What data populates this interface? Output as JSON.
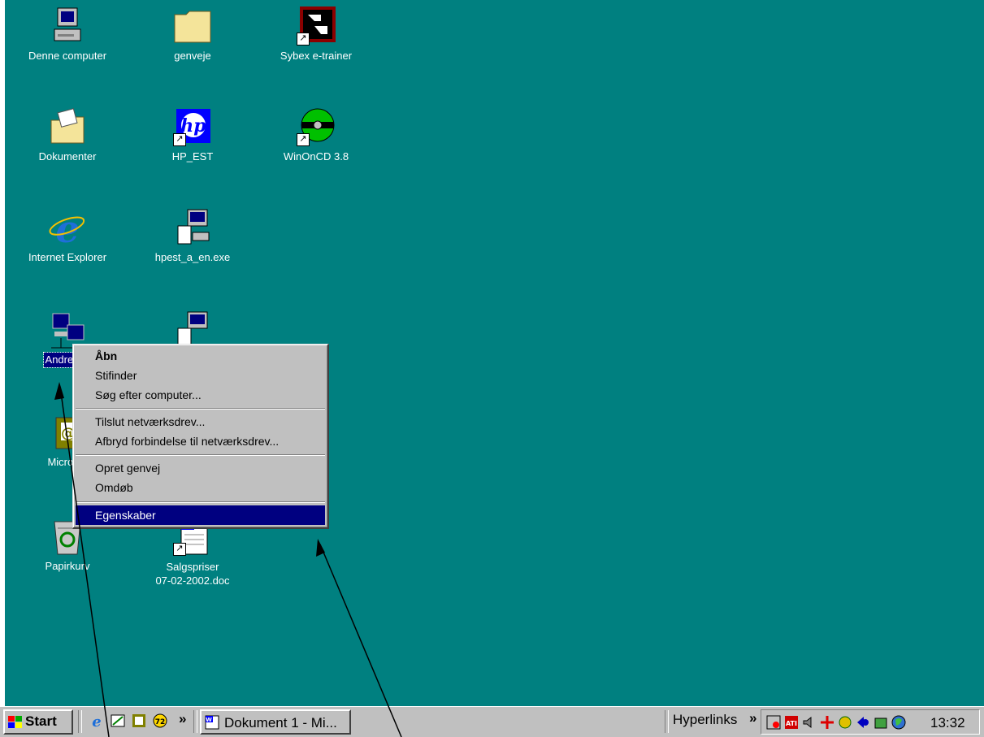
{
  "desktop": {
    "background": "#008080",
    "icons": [
      {
        "label": "Denne computer",
        "glyph": "computer-icon"
      },
      {
        "label": "genveje",
        "glyph": "folder-icon"
      },
      {
        "label": "Sybex e-trainer",
        "glyph": "sybex-icon"
      },
      {
        "label": "Dokumenter",
        "glyph": "documents-folder-icon"
      },
      {
        "label": "HP_EST",
        "glyph": "hp-icon"
      },
      {
        "label": "WinOnCD 3.8",
        "glyph": "cd-icon"
      },
      {
        "label": "Internet Explorer",
        "glyph": "internet-explorer-icon"
      },
      {
        "label": "hpest_a_en.exe",
        "glyph": "installer-icon"
      },
      {
        "label": "Andre Co",
        "glyph": "network-neighborhood-icon"
      },
      {
        "label": "Microsof",
        "glyph": "outlook-icon"
      },
      {
        "label": "Papirkurv",
        "glyph": "recycle-bin-icon"
      },
      {
        "label": "Salgspriser",
        "label2": "07-02-2002.doc",
        "glyph": "word-document-icon"
      }
    ]
  },
  "context_menu": {
    "items": [
      {
        "label": "Åbn",
        "bold": true
      },
      {
        "label": "Stifinder"
      },
      {
        "label": "Søg efter computer..."
      },
      {
        "label": "Tilslut netværksdrev..."
      },
      {
        "label": "Afbryd forbindelse til netværksdrev..."
      },
      {
        "label": "Opret genvej"
      },
      {
        "label": "Omdøb"
      },
      {
        "label": "Egenskaber",
        "highlighted": true
      }
    ],
    "highlight_color": "#000080"
  },
  "taskbar": {
    "start_label": "Start",
    "quicklaunch_more": "»",
    "task_button": "Dokument 1 - Mi...",
    "hyperlinks_label": "Hyperlinks",
    "hyperlinks_more": "»",
    "clock": "13:32"
  }
}
